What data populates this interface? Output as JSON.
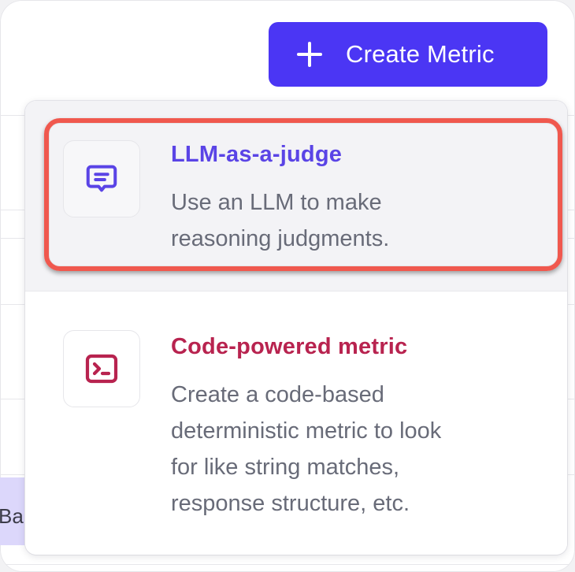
{
  "toolbar": {
    "create_metric_label": "Create Metric",
    "create_icon": "plus-icon"
  },
  "menu": {
    "items": [
      {
        "title": "LLM-as-a-judge",
        "description": "Use an LLM to make\nreasoning judgments.",
        "icon": "chat-message-icon",
        "title_color": "#5a44e6",
        "highlighted": true
      },
      {
        "title": "Code-powered metric",
        "description": "Create a code-based\ndeterministic metric to look\nfor like string matches,\nresponse structure, etc.",
        "icon": "terminal-icon",
        "title_color": "#b8234f",
        "highlighted": false
      }
    ]
  },
  "background": {
    "chip_text": "Ba"
  },
  "colors": {
    "accent": "#4b36f4",
    "highlight_border": "#f0584e"
  }
}
